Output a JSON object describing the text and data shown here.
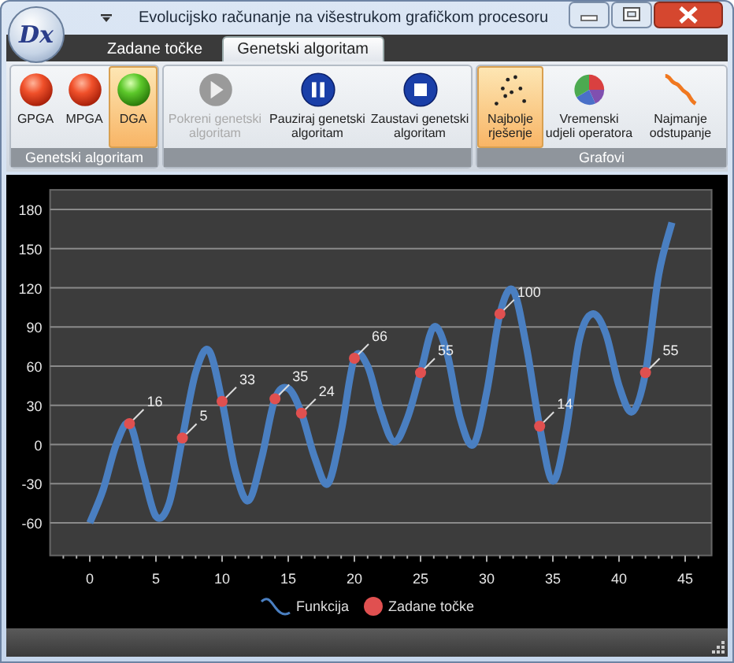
{
  "window": {
    "title": "Evolucijsko računanje na višestrukom grafičkom procesoru",
    "logo": "Dx"
  },
  "tabs": [
    {
      "label": "Zadane točke",
      "selected": false
    },
    {
      "label": "Genetski algoritam",
      "selected": true
    }
  ],
  "ribbon_groups": [
    {
      "caption": "Genetski algoritam",
      "buttons": [
        {
          "label": "GPGA",
          "selected": false,
          "disabled": false
        },
        {
          "label": "MPGA",
          "selected": false,
          "disabled": false
        },
        {
          "label": "DGA",
          "selected": true,
          "disabled": false
        }
      ]
    },
    {
      "buttons": [
        {
          "label": "Pokreni genetski algoritam",
          "selected": false,
          "disabled": true
        },
        {
          "label": "Pauziraj genetski algoritam",
          "selected": false,
          "disabled": false
        },
        {
          "label": "Zaustavi genetski algoritam",
          "selected": false,
          "disabled": false
        }
      ]
    },
    {
      "caption": "Grafovi",
      "buttons": [
        {
          "label": "Najbolje rješenje",
          "selected": true,
          "disabled": false
        },
        {
          "label": "Vremenski udjeli operatora",
          "selected": false,
          "disabled": false
        },
        {
          "label": "Najmanje odstupanje",
          "selected": false,
          "disabled": false
        }
      ]
    }
  ],
  "chart": {
    "chart_data": {
      "type": "line",
      "x": [
        0,
        1,
        2,
        3,
        4,
        5,
        6,
        7,
        8,
        9,
        10,
        11,
        12,
        13,
        14,
        15,
        16,
        17,
        18,
        19,
        20,
        21,
        22,
        23,
        24,
        25,
        26,
        27,
        28,
        29,
        30,
        31,
        32,
        33,
        34,
        35,
        36,
        37,
        38,
        39,
        40,
        41,
        42,
        43,
        44
      ],
      "xlim": [
        -3,
        47
      ],
      "ylim": [
        -85,
        195
      ],
      "xticks": [
        0,
        5,
        10,
        15,
        20,
        25,
        30,
        35,
        40,
        45
      ],
      "yticks": [
        -60,
        -30,
        0,
        30,
        60,
        90,
        120,
        150,
        180
      ],
      "grid": true,
      "legend": "bottom",
      "series": [
        {
          "name": "Funkcija",
          "color": "#4a7fc1",
          "values": [
            -60,
            -35,
            0,
            16,
            -20,
            -55,
            -45,
            5,
            55,
            72,
            33,
            -20,
            -43,
            -10,
            35,
            43,
            24,
            -10,
            -30,
            10,
            66,
            60,
            25,
            2,
            20,
            55,
            90,
            70,
            20,
            0,
            40,
            100,
            118,
            75,
            14,
            -28,
            10,
            80,
            100,
            85,
            45,
            25,
            55,
            130,
            170
          ]
        },
        {
          "name": "Zadane točke",
          "color": "#e05050",
          "marker": "circle",
          "values": [
            null,
            null,
            null,
            16,
            null,
            null,
            null,
            5,
            null,
            null,
            33,
            null,
            null,
            null,
            35,
            null,
            24,
            null,
            null,
            null,
            66,
            null,
            null,
            null,
            null,
            55,
            null,
            null,
            null,
            null,
            null,
            100,
            null,
            null,
            14,
            null,
            null,
            null,
            null,
            null,
            null,
            null,
            55,
            null,
            null
          ],
          "value_labels": [
            null,
            null,
            null,
            "16",
            null,
            null,
            null,
            "5",
            null,
            null,
            "33",
            null,
            null,
            null,
            "35",
            null,
            "24",
            null,
            null,
            null,
            "66",
            null,
            null,
            null,
            null,
            "55",
            null,
            null,
            null,
            null,
            null,
            "100",
            null,
            null,
            "14",
            null,
            null,
            null,
            null,
            null,
            null,
            null,
            "55",
            null,
            null
          ]
        }
      ]
    }
  }
}
